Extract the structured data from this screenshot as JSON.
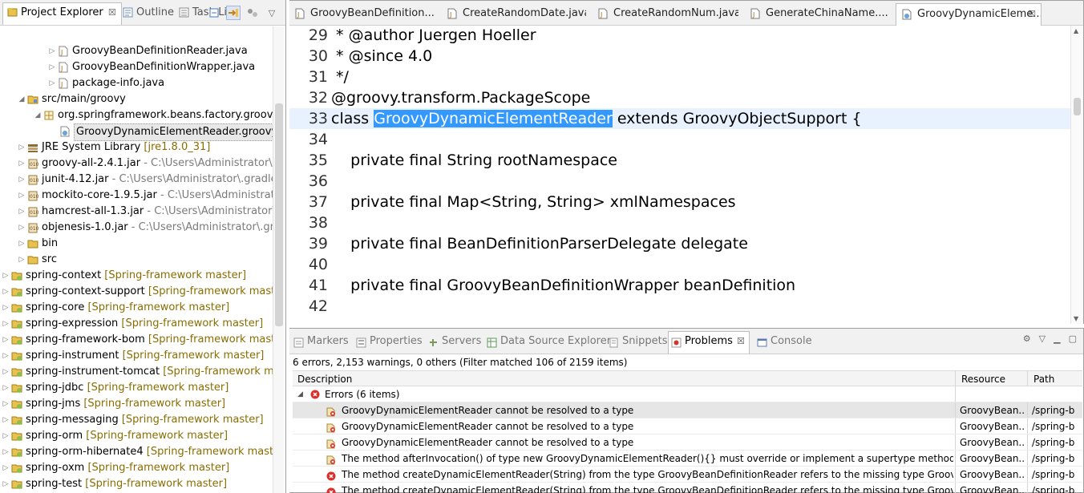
{
  "left_pane": {
    "tabs": [
      {
        "label": "Project Explorer",
        "close": "☒"
      },
      {
        "label": "Outline"
      },
      {
        "label": "Task List"
      }
    ],
    "tree": [
      {
        "label": "GroovyBeanDefinitionReader.java",
        "deco": "",
        "kind": "java",
        "twisty": "closed"
      },
      {
        "label": "GroovyBeanDefinitionWrapper.java",
        "deco": "",
        "kind": "java",
        "twisty": "closed"
      },
      {
        "label": "package-info.java",
        "deco": "",
        "kind": "java",
        "twisty": "closed"
      },
      {
        "label": "src/main/groovy",
        "deco": "",
        "kind": "srcfolder",
        "twisty": "open"
      },
      {
        "label": "org.springframework.beans.factory.groovy",
        "deco": "",
        "kind": "package",
        "twisty": "open"
      },
      {
        "label": "GroovyDynamicElementReader.groovy",
        "deco": "",
        "kind": "groovy",
        "twisty": "none",
        "selected": true
      },
      {
        "label": "JRE System Library",
        "deco": "[jre1.8.0_31]",
        "kind": "library",
        "twisty": "closed"
      },
      {
        "label": "groovy-all-2.4.1.jar",
        "deco": "- C:\\Users\\Administrator\\.gr",
        "kind": "jar",
        "twisty": "closed"
      },
      {
        "label": "junit-4.12.jar",
        "deco": "- C:\\Users\\Administrator\\.gradle\\",
        "kind": "jar",
        "twisty": "closed"
      },
      {
        "label": "mockito-core-1.9.5.jar",
        "deco": "- C:\\Users\\Administrato",
        "kind": "jar",
        "twisty": "closed"
      },
      {
        "label": "hamcrest-all-1.3.jar",
        "deco": "- C:\\Users\\Administrator\\.g",
        "kind": "jar",
        "twisty": "closed"
      },
      {
        "label": "objenesis-1.0.jar",
        "deco": "- C:\\Users\\Administrator\\.gra",
        "kind": "jar",
        "twisty": "closed"
      },
      {
        "label": "bin",
        "deco": "",
        "kind": "folder",
        "twisty": "closed"
      },
      {
        "label": "src",
        "deco": "",
        "kind": "folder",
        "twisty": "closed"
      },
      {
        "label": "spring-context",
        "deco": "[Spring-framework master]",
        "kind": "project",
        "twisty": "closed"
      },
      {
        "label": "spring-context-support",
        "deco": "[Spring-framework maste",
        "kind": "project",
        "twisty": "closed"
      },
      {
        "label": "spring-core",
        "deco": "[Spring-framework master]",
        "kind": "project",
        "twisty": "closed"
      },
      {
        "label": "spring-expression",
        "deco": "[Spring-framework master]",
        "kind": "project",
        "twisty": "closed"
      },
      {
        "label": "spring-framework-bom",
        "deco": "[Spring-framework maste",
        "kind": "project",
        "twisty": "closed"
      },
      {
        "label": "spring-instrument",
        "deco": "[Spring-framework master]",
        "kind": "project",
        "twisty": "closed"
      },
      {
        "label": "spring-instrument-tomcat",
        "deco": "[Spring-framework ma",
        "kind": "project",
        "twisty": "closed"
      },
      {
        "label": "spring-jdbc",
        "deco": "[Spring-framework master]",
        "kind": "project",
        "twisty": "closed"
      },
      {
        "label": "spring-jms",
        "deco": "[Spring-framework master]",
        "kind": "project",
        "twisty": "closed"
      },
      {
        "label": "spring-messaging",
        "deco": "[Spring-framework master]",
        "kind": "project",
        "twisty": "closed"
      },
      {
        "label": "spring-orm",
        "deco": "[Spring-framework master]",
        "kind": "project",
        "twisty": "closed"
      },
      {
        "label": "spring-orm-hibernate4",
        "deco": "[Spring-framework maste",
        "kind": "project",
        "twisty": "closed"
      },
      {
        "label": "spring-oxm",
        "deco": "[Spring-framework master]",
        "kind": "project",
        "twisty": "closed"
      },
      {
        "label": "spring-test",
        "deco": "[Spring-framework master]",
        "kind": "project",
        "twisty": "closed"
      }
    ]
  },
  "editor": {
    "tabs": [
      {
        "label": "GroovyBeanDefinition...",
        "active": false
      },
      {
        "label": "CreateRandomDate.java",
        "active": false
      },
      {
        "label": "CreateRandomNum.java",
        "active": false
      },
      {
        "label": "GenerateChinaName....",
        "active": false
      },
      {
        "label": "GroovyDynamicEleme...",
        "active": true,
        "close": "☒"
      }
    ],
    "lines": [
      {
        "n": "29",
        "pre": " * @author Juergen Hoeller",
        "sel": "",
        "post": ""
      },
      {
        "n": "30",
        "pre": " * @since 4.0",
        "sel": "",
        "post": ""
      },
      {
        "n": "31",
        "pre": " */",
        "sel": "",
        "post": ""
      },
      {
        "n": "32",
        "pre": "@groovy.transform.PackageScope",
        "sel": "",
        "post": ""
      },
      {
        "n": "33",
        "pre": "class ",
        "sel": "GroovyDynamicElementReader",
        "post": " extends GroovyObjectSupport {",
        "current": true
      },
      {
        "n": "34",
        "pre": "",
        "sel": "",
        "post": ""
      },
      {
        "n": "35",
        "pre": "    private final String rootNamespace",
        "sel": "",
        "post": ""
      },
      {
        "n": "36",
        "pre": "",
        "sel": "",
        "post": ""
      },
      {
        "n": "37",
        "pre": "    private final Map<String, String> xmlNamespaces",
        "sel": "",
        "post": ""
      },
      {
        "n": "38",
        "pre": "",
        "sel": "",
        "post": ""
      },
      {
        "n": "39",
        "pre": "    private final BeanDefinitionParserDelegate delegate",
        "sel": "",
        "post": ""
      },
      {
        "n": "40",
        "pre": "",
        "sel": "",
        "post": ""
      },
      {
        "n": "41",
        "pre": "    private final GroovyBeanDefinitionWrapper beanDefinition",
        "sel": "",
        "post": ""
      },
      {
        "n": "42",
        "pre": "",
        "sel": "",
        "post": ""
      }
    ]
  },
  "bottom": {
    "tabs": [
      {
        "label": "Markers",
        "icon": "markers-icon"
      },
      {
        "label": "Properties",
        "icon": "properties-icon"
      },
      {
        "label": "Servers",
        "icon": "servers-icon"
      },
      {
        "label": "Data Source Explorer",
        "icon": "datasource-icon"
      },
      {
        "label": "Snippets",
        "icon": "snippets-icon"
      },
      {
        "label": "Problems",
        "icon": "problems-icon",
        "active": true,
        "close": "☒"
      },
      {
        "label": "Console",
        "icon": "console-icon"
      }
    ],
    "summary": "6 errors, 2,153 warnings, 0 others (Filter matched 106 of 2159 items)",
    "columns": {
      "description": "Description",
      "resource": "Resource",
      "path": "Path"
    },
    "group": {
      "label": "Errors (6 items)"
    },
    "rows": [
      {
        "desc": "GroovyDynamicElementReader cannot be resolved to a type",
        "resource": "GroovyBean...",
        "path": "/spring-b",
        "icon": "error-marker-icon",
        "selected": true
      },
      {
        "desc": "GroovyDynamicElementReader cannot be resolved to a type",
        "resource": "GroovyBean...",
        "path": "/spring-b",
        "icon": "error-marker-icon"
      },
      {
        "desc": "GroovyDynamicElementReader cannot be resolved to a type",
        "resource": "GroovyBean...",
        "path": "/spring-b",
        "icon": "error-marker-icon"
      },
      {
        "desc": "The method afterInvocation() of type new GroovyDynamicElementReader(){} must override or implement a supertype method",
        "resource": "GroovyBean...",
        "path": "/spring-b",
        "icon": "error-marker-icon"
      },
      {
        "desc": "The method createDynamicElementReader(String) from the type GroovyBeanDefinitionReader refers to the missing type GroovyDyn",
        "resource": "GroovyBean...",
        "path": "/spring-b",
        "icon": "error-circle-icon"
      },
      {
        "desc": "The method createDynamicElementReader(String) from the type GroovyBeanDefinitionReader refers to the missing type GroovyDyn",
        "resource": "GroovyBean...",
        "path": "/spring-b",
        "icon": "error-circle-icon"
      }
    ]
  },
  "colors": {
    "selection": "#3399ff",
    "current_line": "#e8f2fe",
    "decoration": "#8a6d00",
    "error": "#d9302c"
  }
}
